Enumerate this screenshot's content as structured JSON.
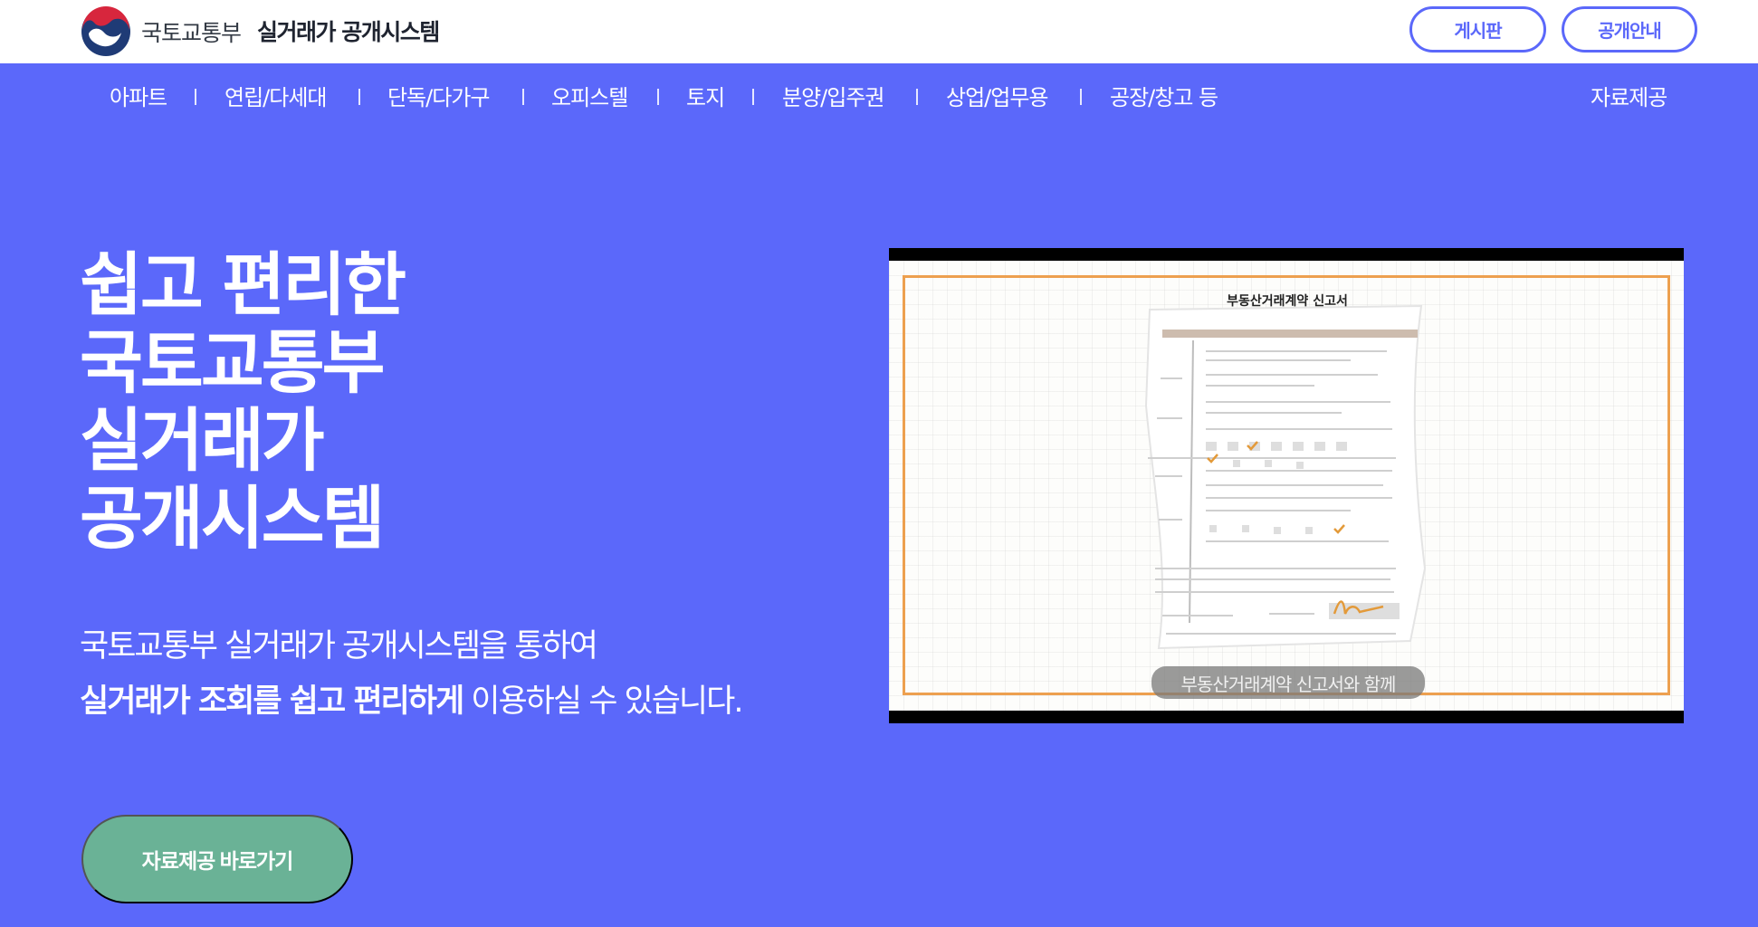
{
  "header": {
    "ministry": "국토교통부",
    "system_name": "실거래가 공개시스템",
    "buttons": {
      "board": "게시판",
      "guide": "공개안내"
    }
  },
  "nav": {
    "items": [
      "아파트",
      "연립/다세대",
      "단독/다가구",
      "오피스텔",
      "토지",
      "분양/입주권",
      "상업/업무용",
      "공장/창고 등"
    ],
    "right": "자료제공"
  },
  "hero": {
    "title_lines": [
      "쉽고 편리한",
      "국토교통부",
      "실거래가",
      "공개시스템"
    ],
    "desc_line1": "국토교통부 실거래가 공개시스템을 통하여",
    "desc_line2_bold": "실거래가 조회를 쉽고 편리하게",
    "desc_line2_rest": " 이용하실 수 있습니다.",
    "cta": "자료제공 바로가기"
  },
  "video": {
    "doc_title": "부동산거래계약 신고서",
    "caption": "부동산거래계약 신고서와 함께"
  },
  "colors": {
    "accent": "#5b68fa",
    "cta": "#6ab296",
    "frame": "#eda04f"
  }
}
